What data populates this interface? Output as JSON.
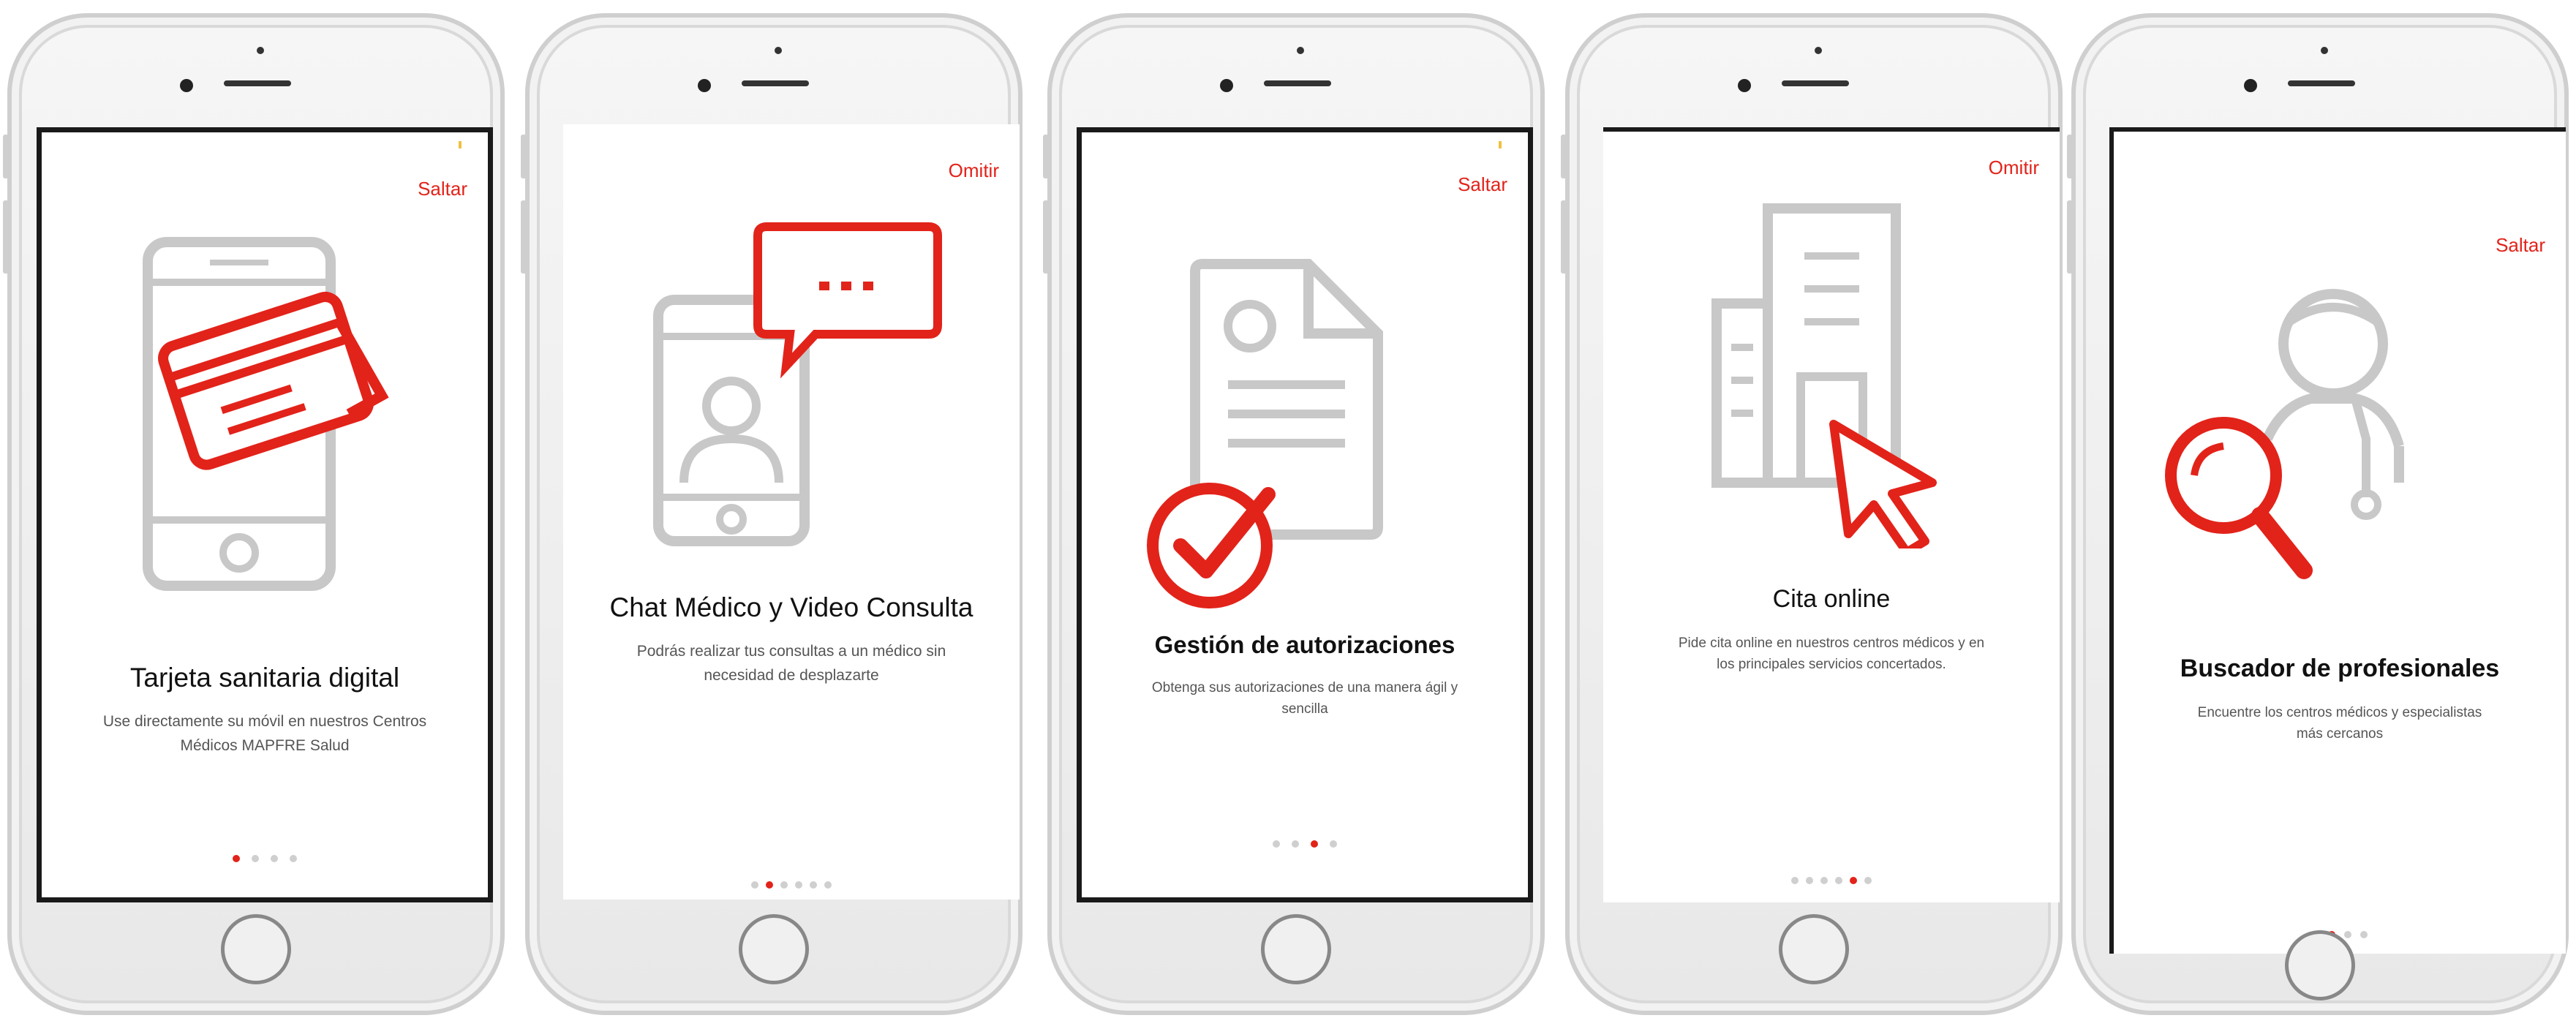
{
  "colors": {
    "accent": "#e2231a",
    "icon_gray": "#c8c8c8",
    "text": "#111111"
  },
  "screens": [
    {
      "skip_label": "Saltar",
      "title": "Tarjeta sanitaria digital",
      "description": "Use directamente su móvil en nuestros Centros Médicos MAPFRE Salud",
      "icon": "phone-card-icon",
      "dots_total": 4,
      "dots_active": 0
    },
    {
      "skip_label": "Omitir",
      "title": "Chat Médico y Video Consulta",
      "description": "Podrás realizar tus consultas a un médico sin necesidad de desplazarte",
      "icon": "phone-chat-icon",
      "dots_total": 6,
      "dots_active": 1
    },
    {
      "skip_label": "Saltar",
      "title": "Gestión de autorizaciones",
      "description": "Obtenga sus autorizaciones de una manera ágil y sencilla",
      "icon": "document-check-icon",
      "dots_total": 4,
      "dots_active": 2
    },
    {
      "skip_label": "Omitir",
      "title": "Cita online",
      "description": "Pide cita online en nuestros centros médicos y en los principales servicios concertados.",
      "icon": "building-cursor-icon",
      "dots_total": 6,
      "dots_active": 4
    },
    {
      "skip_label": "Saltar",
      "title": "Buscador de profesionales",
      "description": "Encuentre los centros médicos y especialistas más cercanos",
      "icon": "doctor-search-icon",
      "dots_total": 4,
      "dots_active": 1
    }
  ]
}
